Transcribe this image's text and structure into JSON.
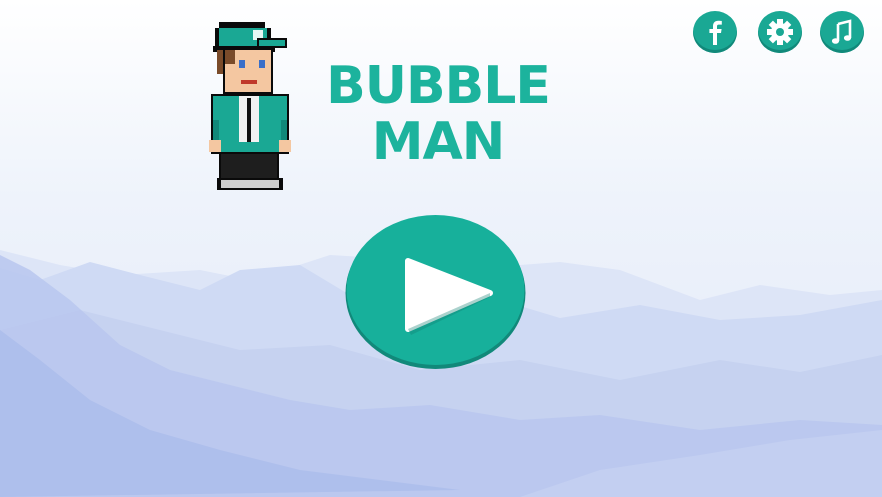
{
  "game": {
    "title_line1": "BUBBLE",
    "title_line2": "MAN"
  },
  "buttons": {
    "facebook_icon": "facebook-icon",
    "settings_icon": "gear-icon",
    "music_icon": "music-note-icon",
    "play_icon": "play-icon"
  },
  "colors": {
    "accent": "#1cb39d",
    "button_bg": "#1aa894",
    "play_bg": "#17b09b"
  }
}
